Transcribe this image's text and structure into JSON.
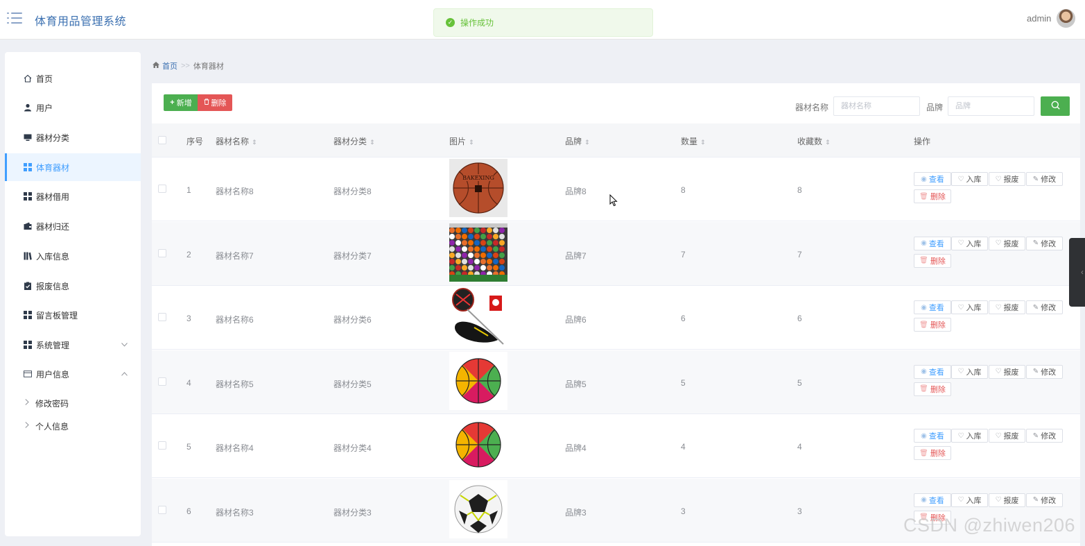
{
  "header": {
    "app_title": "体育用品管理系统",
    "toast": "操作成功",
    "user": "admin"
  },
  "sidebar": {
    "items": [
      {
        "label": "首页",
        "icon": "home-icon"
      },
      {
        "label": "用户",
        "icon": "user-icon"
      },
      {
        "label": "器材分类",
        "icon": "monitor-icon"
      },
      {
        "label": "体育器材",
        "icon": "grid-icon",
        "active": true
      },
      {
        "label": "器材借用",
        "icon": "grid-icon"
      },
      {
        "label": "器材归还",
        "icon": "wallet-icon"
      },
      {
        "label": "入库信息",
        "icon": "books-icon"
      },
      {
        "label": "报废信息",
        "icon": "clipboard-check-icon"
      },
      {
        "label": "留言板管理",
        "icon": "grid-icon"
      },
      {
        "label": "系统管理",
        "icon": "grid-icon",
        "expandable": true,
        "expanded": false
      },
      {
        "label": "用户信息",
        "icon": "id-card-icon",
        "expandable": true,
        "expanded": true
      }
    ],
    "sub_items": [
      {
        "label": "修改密码"
      },
      {
        "label": "个人信息"
      }
    ]
  },
  "breadcrumb": {
    "home": "首页",
    "separator": ">>",
    "current": "体育器材"
  },
  "toolbar": {
    "add_label": "新增",
    "delete_label": "删除",
    "name_label": "器材名称",
    "name_placeholder": "器材名称",
    "brand_label": "品牌",
    "brand_placeholder": "品牌"
  },
  "table": {
    "columns": [
      "序号",
      "器材名称",
      "器材分类",
      "图片",
      "品牌",
      "数量",
      "收藏数",
      "操作"
    ],
    "actions": [
      "查看",
      "入库",
      "报废",
      "修改",
      "删除"
    ],
    "rows": [
      {
        "no": "1",
        "name": "器材名称8",
        "category": "器材分类8",
        "image": "basketball-brown",
        "brand": "品牌8",
        "qty": "8",
        "fav": "8"
      },
      {
        "no": "2",
        "name": "器材名称7",
        "category": "器材分类7",
        "image": "ball-shelves",
        "brand": "品牌7",
        "qty": "7",
        "fav": "7"
      },
      {
        "no": "3",
        "name": "器材名称6",
        "category": "器材分类6",
        "image": "badminton-racket",
        "brand": "品牌6",
        "qty": "6",
        "fav": "6"
      },
      {
        "no": "4",
        "name": "器材名称5",
        "category": "器材分类5",
        "image": "basketball-colorful",
        "brand": "品牌5",
        "qty": "5",
        "fav": "5"
      },
      {
        "no": "5",
        "name": "器材名称4",
        "category": "器材分类4",
        "image": "basketball-colorful",
        "brand": "品牌4",
        "qty": "4",
        "fav": "4"
      },
      {
        "no": "6",
        "name": "器材名称3",
        "category": "器材分类3",
        "image": "soccer-ball",
        "brand": "品牌3",
        "qty": "3",
        "fav": "3"
      }
    ]
  },
  "watermark": "CSDN @zhiwen206",
  "colors": {
    "primary": "#409eff",
    "success": "#4caf50",
    "danger": "#e45656"
  }
}
